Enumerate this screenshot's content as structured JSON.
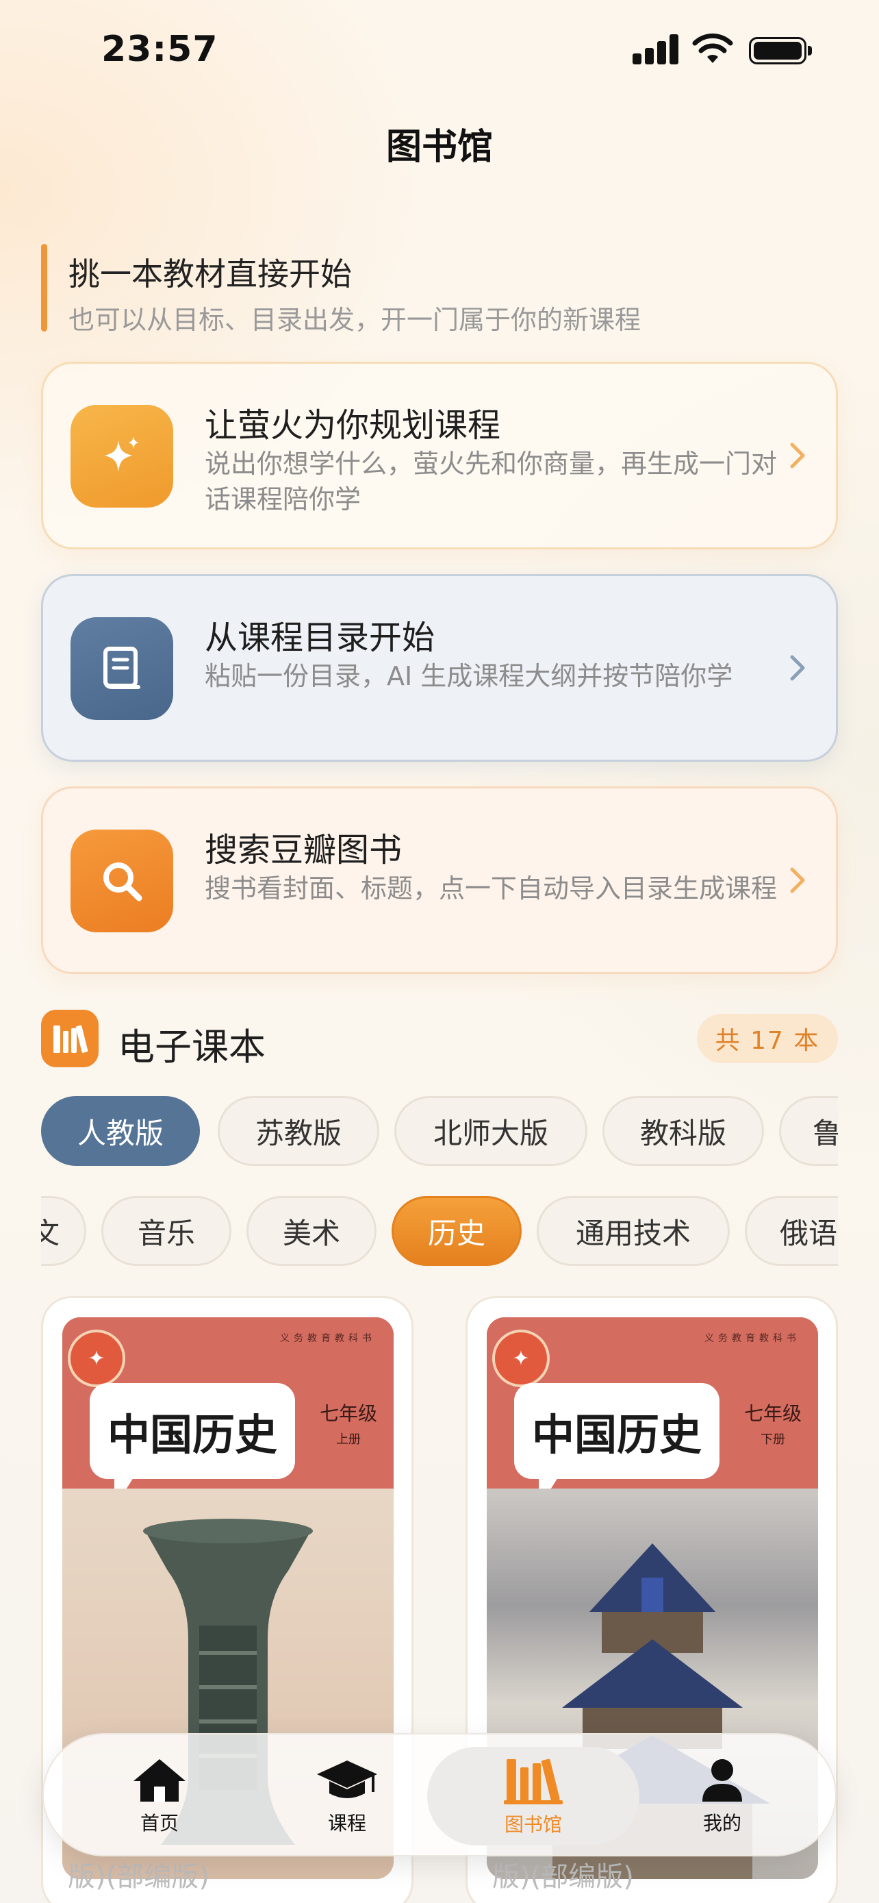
{
  "status_bar": {
    "time": "23:57"
  },
  "header": {
    "title": "图书馆"
  },
  "intro": {
    "title": "挑一本教材直接开始",
    "subtitle": "也可以从目标、目录出发，开一门属于你的新课程"
  },
  "actions": [
    {
      "title": "让萤火为你规划课程",
      "desc": "说出你想学什么，萤火先和你商量，再生成一门对话课程陪你学",
      "icon": "sparkles-icon"
    },
    {
      "title": "从课程目录开始",
      "desc": "粘贴一份目录，AI 生成课程大纲并按节陪你学",
      "icon": "book-icon"
    },
    {
      "title": "搜索豆瓣图书",
      "desc": "搜书看封面、标题，点一下自动导入目录生成课程",
      "icon": "search-icon"
    }
  ],
  "section": {
    "title": "电子课本",
    "count": "共 17 本",
    "icon": "bookshelf-icon"
  },
  "publishers": [
    "人教版",
    "苏教版",
    "北师大版",
    "教科版",
    "鲁"
  ],
  "publishers_selected": "人教版",
  "subjects": [
    "文",
    "音乐",
    "美术",
    "历史",
    "通用技术",
    "俄语"
  ],
  "subjects_selected": "历史",
  "books": [
    {
      "cover_title": "中国历史",
      "grade": "七年级",
      "volume": "上册",
      "series": "义务教育教科书",
      "caption": "版)(部编版)"
    },
    {
      "cover_title": "中国历史",
      "grade": "七年级",
      "volume": "下册",
      "series": "义务教育教科书",
      "caption": "版)(部编版)"
    }
  ],
  "tabs": [
    {
      "label": "首页",
      "icon": "home-icon"
    },
    {
      "label": "课程",
      "icon": "graduation-cap-icon"
    },
    {
      "label": "图书馆",
      "icon": "bookshelf-icon"
    },
    {
      "label": "我的",
      "icon": "user-icon"
    }
  ],
  "tabs_selected": "图书馆",
  "colors": {
    "accent": "#ef8a25",
    "blue": "#557496"
  }
}
